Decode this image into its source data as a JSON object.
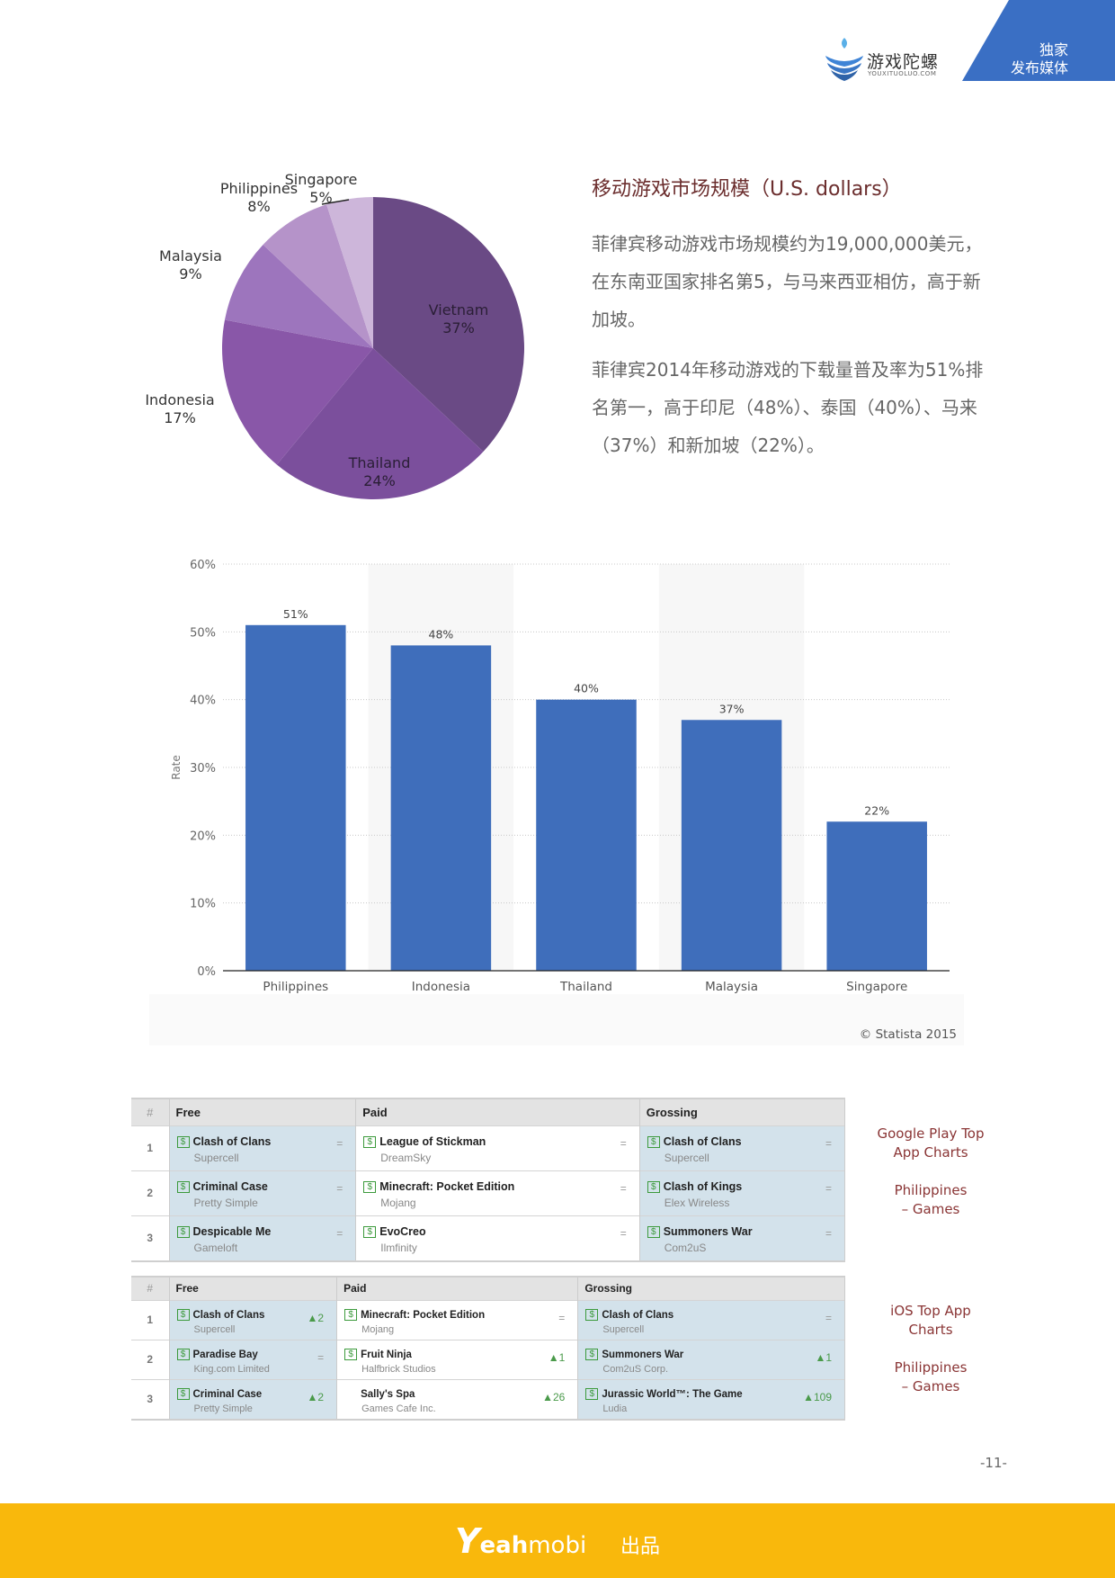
{
  "header": {
    "logo_cn": "游戏陀螺",
    "logo_en": "YOUXITUOLUO.COM",
    "banner_line1": "独家",
    "banner_line2": "发布媒体",
    "colors": {
      "banner": "#3a6fc4",
      "logo_blue": "#3f84d6"
    }
  },
  "intro": {
    "title": "移动游戏市场规模（U.S. dollars）",
    "paragraph1": "菲律宾移动游戏市场规模约为19,000,000美元，在东南亚国家排名第5，与马来西亚相仿，高于新加坡。",
    "paragraph2": "菲律宾2014年移动游戏的下载量普及率为51%排名第一，高于印尼（48%）、泰国（40%）、马来（37%）和新加坡（22%）。"
  },
  "chart_data": [
    {
      "type": "pie",
      "title": "Mobile game market size (U.S. dollars)",
      "categories": [
        "Vietnam",
        "Thailand",
        "Indonesia",
        "Malaysia",
        "Philippines",
        "Singapore"
      ],
      "values": [
        37,
        24,
        17,
        9,
        8,
        5
      ],
      "labels": [
        "37%",
        "24%",
        "17%",
        "9%",
        "8%",
        "5%"
      ],
      "colors": [
        "#6a4a85",
        "#7b4f9c",
        "#8957a8",
        "#9d75bd",
        "#b593c9",
        "#cdb6da"
      ]
    },
    {
      "type": "bar",
      "title": "",
      "categories": [
        "Philippines",
        "Indonesia",
        "Thailand",
        "Malaysia",
        "Singapore"
      ],
      "values": [
        51,
        48,
        40,
        37,
        22
      ],
      "labels": [
        "51%",
        "48%",
        "40%",
        "37%",
        "22%"
      ],
      "xlabel": "",
      "ylabel": "Rate",
      "ylim": [
        0,
        60
      ],
      "yticks": [
        "0%",
        "10%",
        "20%",
        "30%",
        "40%",
        "50%",
        "60%"
      ],
      "grid": true,
      "bar_color": "#3f6ebb",
      "source": "© Statista 2015"
    }
  ],
  "google_play": {
    "headers": [
      "#",
      "Free",
      "Paid",
      "Grossing"
    ],
    "rows": [
      {
        "rank": "1",
        "free": {
          "app": "Clash of Clans",
          "dev": "Supercell",
          "change": "="
        },
        "paid": {
          "app": "League of Stickman",
          "dev": "DreamSky",
          "change": "="
        },
        "grossing": {
          "app": "Clash of Clans",
          "dev": "Supercell",
          "change": "="
        }
      },
      {
        "rank": "2",
        "free": {
          "app": "Criminal Case",
          "dev": "Pretty Simple",
          "change": "="
        },
        "paid": {
          "app": "Minecraft: Pocket Edition",
          "dev": "Mojang",
          "change": "="
        },
        "grossing": {
          "app": "Clash of Kings",
          "dev": "Elex Wireless",
          "change": "="
        }
      },
      {
        "rank": "3",
        "free": {
          "app": "Despicable Me",
          "dev": "Gameloft",
          "change": "="
        },
        "paid": {
          "app": "EvoCreo",
          "dev": "Ilmfinity",
          "change": "="
        },
        "grossing": {
          "app": "Summoners War",
          "dev": "Com2uS",
          "change": "="
        }
      }
    ],
    "caption_line1": "Google Play Top",
    "caption_line2": "App Charts",
    "caption_line3": "Philippines",
    "caption_line4": "– Games"
  },
  "ios": {
    "headers": [
      "#",
      "Free",
      "Paid",
      "Grossing"
    ],
    "rows": [
      {
        "rank": "1",
        "free": {
          "app": "Clash of Clans",
          "dev": "Supercell",
          "change": "▲2"
        },
        "paid": {
          "app": "Minecraft: Pocket Edition",
          "dev": "Mojang",
          "change": "="
        },
        "grossing": {
          "app": "Clash of Clans",
          "dev": "Supercell",
          "change": "="
        }
      },
      {
        "rank": "2",
        "free": {
          "app": "Paradise Bay",
          "dev": "King.com Limited",
          "change": "="
        },
        "paid": {
          "app": "Fruit Ninja",
          "dev": "Halfbrick Studios",
          "change": "▲1"
        },
        "grossing": {
          "app": "Summoners War",
          "dev": "Com2uS Corp.",
          "change": "▲1"
        }
      },
      {
        "rank": "3",
        "free": {
          "app": "Criminal Case",
          "dev": "Pretty Simple",
          "change": "▲2"
        },
        "paid": {
          "app": "Sally's Spa",
          "dev": "Games Cafe Inc.",
          "change": "▲26"
        },
        "grossing": {
          "app": "Jurassic World™: The Game",
          "dev": "Ludia",
          "change": "▲109"
        }
      }
    ],
    "caption_line1": "iOS Top App",
    "caption_line2": "Charts",
    "caption_line3": "Philippines",
    "caption_line4": "– Games"
  },
  "page_number": "-11-",
  "footer": {
    "brand_y": "Y",
    "brand_eah": "eah",
    "brand_mobi": "mobi",
    "produced_by": "出品",
    "color": "#f9b80c"
  }
}
